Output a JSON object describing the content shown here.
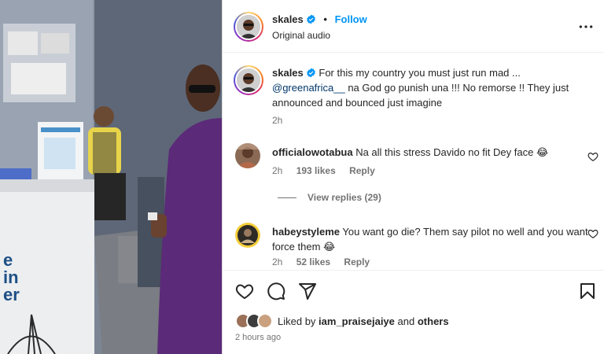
{
  "post": {
    "username": "skales",
    "follow_label": "Follow",
    "separator": "•",
    "audio": "Original audio",
    "more_icon": "more-horizontal-icon"
  },
  "caption": {
    "username": "skales",
    "text_part1": "For this my country you must just run mad ...",
    "mention": "@greenafrica__",
    "text_part2": "na God go punish una !!! No remorse !! They just announced and bounced just imagine",
    "time": "2h"
  },
  "comments": [
    {
      "username": "officialowotabua",
      "text": "Na all this stress Davido no fit Dey face 😂",
      "time": "2h",
      "likes": "193 likes",
      "reply_label": "Reply",
      "view_replies": "View replies (29)"
    },
    {
      "username": "habeystyleme",
      "text": "You want go die? Them say pilot no well and you want force them 😂",
      "time": "2h",
      "likes": "52 likes",
      "reply_label": "Reply"
    }
  ],
  "actions": {
    "like_icon": "heart-icon",
    "comment_icon": "comment-icon",
    "share_icon": "share-icon",
    "save_icon": "bookmark-icon"
  },
  "likes_summary": {
    "prefix": "Liked by",
    "user": "iam_praisejaiye",
    "joiner": "and",
    "others": "others"
  },
  "posted_ago": "2 hours ago",
  "video_overlay_text": [
    "e",
    "in",
    "er"
  ],
  "colors": {
    "follow_blue": "#0095f6",
    "mention_blue": "#00376b",
    "verified_blue": "#0095f6",
    "muted_text": "#737373"
  }
}
